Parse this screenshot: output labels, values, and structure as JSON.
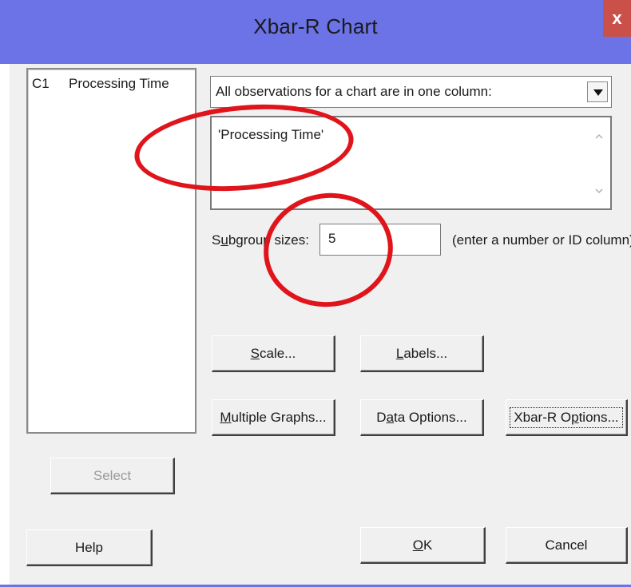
{
  "window": {
    "title": "Xbar-R Chart",
    "close_glyph": "x"
  },
  "variables": {
    "items": [
      {
        "id": "C1",
        "name": "Processing Time"
      }
    ]
  },
  "chart_for": {
    "selected": "All observations for a chart are in one column:"
  },
  "columns_box": {
    "value": "'Processing Time'"
  },
  "subgroup": {
    "label_pre": "S",
    "label_ul": "u",
    "label_post": "bgroup sizes:",
    "value": "5",
    "hint": "(enter a number or ID column)"
  },
  "buttons": {
    "scale": {
      "ul": "S",
      "rest": "cale..."
    },
    "labels": {
      "ul": "L",
      "rest": "abels..."
    },
    "multiple_graphs": {
      "ul": "M",
      "rest": "ultiple Graphs..."
    },
    "data_options": {
      "pre": "D",
      "ul": "a",
      "rest": "ta Options..."
    },
    "xbar_options": {
      "pre": "Xbar-R O",
      "ul": "p",
      "rest": "tions..."
    },
    "select": "Select",
    "help": "Help",
    "ok": {
      "ul": "O",
      "rest": "K"
    },
    "cancel": "Cancel"
  },
  "colors": {
    "titlebar": "#6b73e6",
    "close": "#c9514a",
    "annotation": "#e0141b",
    "dialog": "#f0f0f0"
  }
}
